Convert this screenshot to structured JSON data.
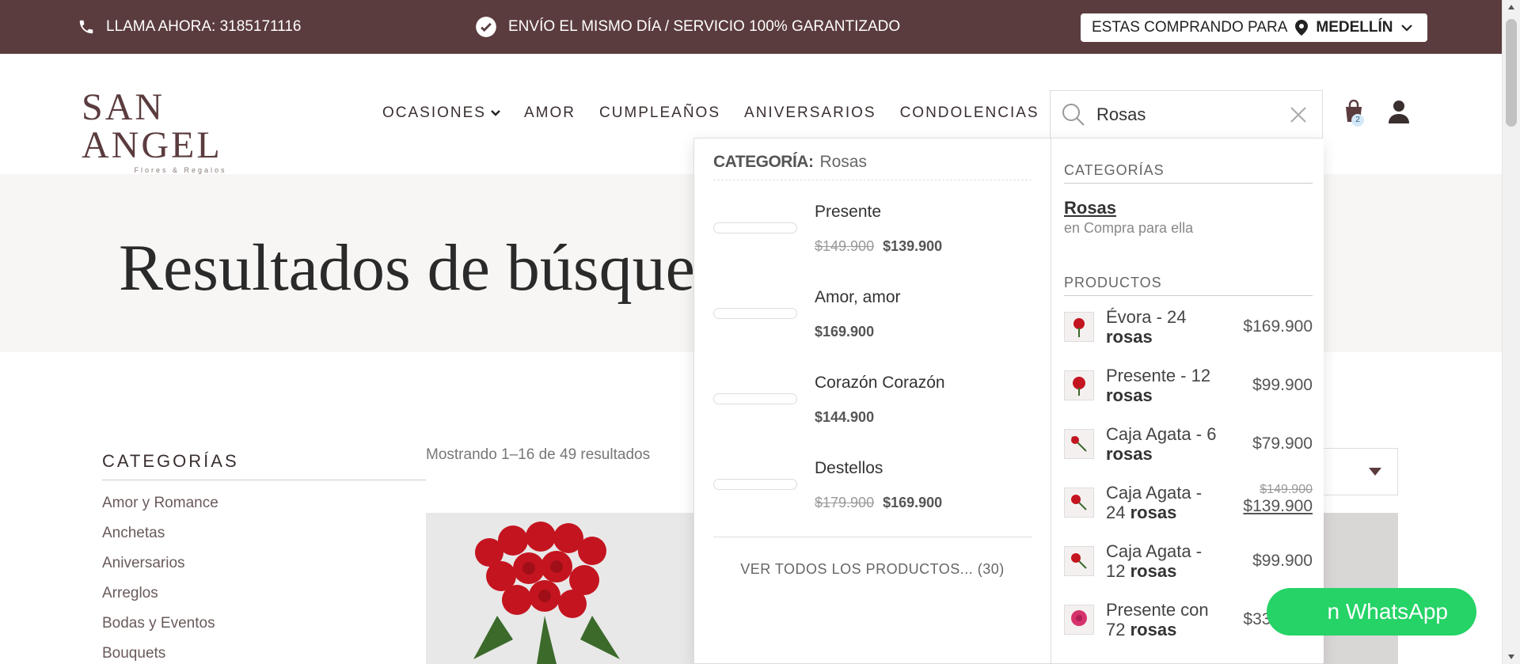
{
  "topbar": {
    "phone_text": "LLAMA AHORA: 3185171116",
    "shipping_text": "ENVÍO EL MISMO DÍA / SERVICIO 100% GARANTIZADO",
    "location_label": "ESTAS COMPRANDO PARA",
    "location_city": "MEDELLÍN"
  },
  "header": {
    "logo_main": "SAN ANGEL",
    "logo_sub": "Flores & Regalos",
    "nav": [
      "OCASIONES",
      "AMOR",
      "CUMPLEAÑOS",
      "ANIVERSARIOS",
      "CONDOLENCIAS"
    ],
    "search_value": "Rosas",
    "cart_count": "2"
  },
  "hero": {
    "title": "Resultados de búsque"
  },
  "sidebar": {
    "title": "CATEGORÍAS",
    "items": [
      "Amor y Romance",
      "Anchetas",
      "Aniversarios",
      "Arreglos",
      "Bodas y Eventos",
      "Bouquets"
    ]
  },
  "results": {
    "count_text": "Mostrando 1–16 de 49 resultados"
  },
  "dropdown": {
    "category_label": "CATEGORÍA:",
    "category_value": "Rosas",
    "products": [
      {
        "name": "Presente",
        "old_price": "$149.900",
        "price": "$139.900"
      },
      {
        "name": "Amor, amor",
        "old_price": "",
        "price": "$169.900"
      },
      {
        "name": "Corazón Corazón",
        "old_price": "",
        "price": "$144.900"
      },
      {
        "name": "Destellos",
        "old_price": "$179.900",
        "price": "$169.900"
      }
    ],
    "view_all": "VER TODOS LOS PRODUCTOS... (30)",
    "right": {
      "categories_title": "CATEGORÍAS",
      "category_link": "Rosas",
      "category_sub": "en Compra para ella",
      "products_title": "PRODUCTOS",
      "products": [
        {
          "name": "Évora - 24",
          "bold": "rosas",
          "old_price": "",
          "price": "$169.900"
        },
        {
          "name": "Presente - 12",
          "bold": "rosas",
          "old_price": "",
          "price": "$99.900"
        },
        {
          "name": "Caja Agata - 6",
          "bold": "rosas",
          "old_price": "",
          "price": "$79.900"
        },
        {
          "name": "Caja Agata - 24",
          "bold": "rosas",
          "old_price": "$149.900",
          "price": "$139.900"
        },
        {
          "name": "Caja Agata - 12",
          "bold": "rosas",
          "old_price": "",
          "price": "$99.900"
        },
        {
          "name": "Presente con 72",
          "bold": "rosas",
          "old_price": "",
          "price": "$339.900"
        }
      ]
    }
  },
  "whatsapp": {
    "label": "n WhatsApp"
  },
  "colors": {
    "brand": "#5b3c3e",
    "whatsapp": "#25d366",
    "hero_bg": "#f7f6f4"
  }
}
